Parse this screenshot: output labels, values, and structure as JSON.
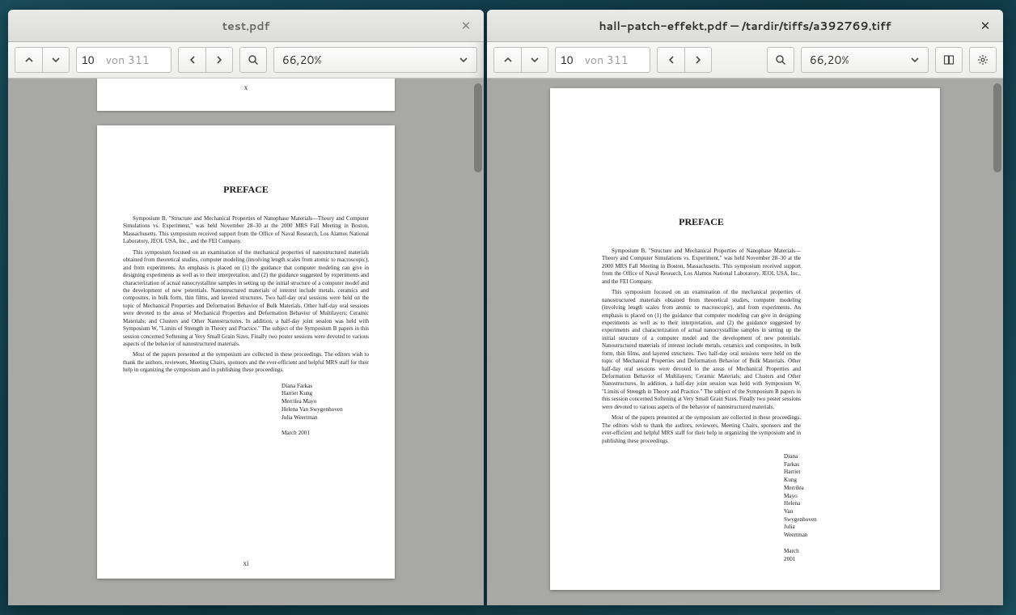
{
  "left_window": {
    "title": "test.pdf",
    "toolbar": {
      "page_current": "10",
      "page_total_label": "von 311",
      "zoom": "66,20%"
    },
    "prev_page_marker": "x",
    "page_marker": "xi"
  },
  "right_window": {
    "title": "hall-patch-effekt.pdf — /tardir/tiffs/a392769.tiff",
    "toolbar": {
      "page_current": "10",
      "page_total_label": "von 311",
      "zoom": "66,20%"
    }
  },
  "document": {
    "heading": "PREFACE",
    "para1": "Symposium B, \"Structure and Mechanical Properties of Nanophase Materials—Theory and Computer Simulations vs. Experiment,\" was held November 28–30 at the 2000 MRS Fall Meeting in Boston, Massachusetts. This symposium received support from the Office of Naval Research, Los Alamos National Laboratory, JEOL USA, Inc., and the FEI Company.",
    "para2": "This symposium focused on an examination of the mechanical properties of nanostructured materials obtained from theoretical studies, computer modeling (involving length scales from atomic to macroscopic), and from experiments. An emphasis is placed on (1) the guidance that computer modeling can give in designing experiments as well as to their interpretation, and (2) the guidance suggested by experiments and characterization of actual nanocrystalline samples in setting up the initial structure of a computer model and the development of new potentials. Nanostructured materials of interest include metals, ceramics and composites, in bulk form, thin films, and layered structures. Two half-day oral sessions were held on the topic of Mechanical Properties and Deformation Behavior of Bulk Materials. Other half-day oral sessions were devoted to the areas of Mechanical Properties and Deformation Behavior of Multilayers; Ceramic Materials; and Clusters and Other Nanostructures. In addition, a half-day joint session was held with Symposium W, \"Limits of Strength in Theory and Practice.\" The subject of the Symposium B papers in this session concerned Softening at Very Small Grain Sizes. Finally two poster sessions were devoted to various aspects of the behavior of nanostructured materials.",
    "para3": "Most of the papers presented at the symposium are collected in these proceedings. The editors wish to thank the authors, reviewers, Meeting Chairs, sponsors and the ever-efficient and helpful MRS staff for their help in organizing the symposium and in publishing these proceedings.",
    "authors": [
      "Diana Farkas",
      "Harriet Kung",
      "Merrilea Mayo",
      "Helena Van Swygenhoven",
      "Julia Weertman"
    ],
    "date": "March 2001"
  }
}
